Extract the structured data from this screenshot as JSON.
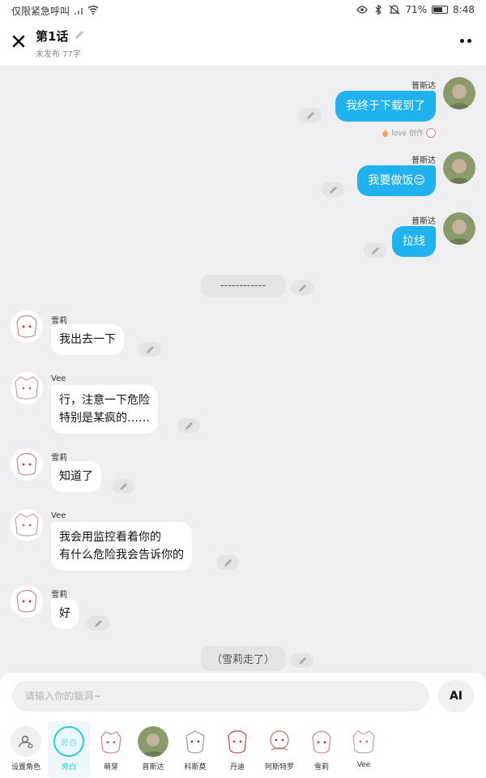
{
  "status_bar": {
    "left_text": "仅限紧急呼叫",
    "battery": "71%",
    "time": "8:48"
  },
  "header": {
    "title": "第1话",
    "subtitle": "未发布 77字"
  },
  "messages": {
    "m1": {
      "name": "普斯达",
      "text": "我终于下载到了"
    },
    "credit": "love 创作",
    "m2": {
      "name": "普斯达",
      "text": "我要做饭😌"
    },
    "m3": {
      "name": "普斯达",
      "text": "拉线"
    },
    "narr1": {
      "text": "------------"
    },
    "m4": {
      "name": "雪莉",
      "text": "我出去一下"
    },
    "m5": {
      "name": "Vee",
      "line1": "行，注意一下危险",
      "line2": "特别是某疯的……"
    },
    "m6": {
      "name": "雪莉",
      "text": "知道了"
    },
    "m7": {
      "name": "Vee",
      "line1": "我会用监控看着你的",
      "line2": "有什么危险我会告诉你的"
    },
    "m8": {
      "name": "雪莉",
      "text": "好"
    },
    "narr2": {
      "text": "（雪莉走了）"
    }
  },
  "input": {
    "placeholder": "请输入你的脑洞~",
    "ai_label": "AI"
  },
  "characters": [
    {
      "label": "设置角色",
      "icon": "add-user-icon"
    },
    {
      "label": "旁白",
      "avatar_text": "旁白",
      "selected": true
    },
    {
      "label": "萌芽"
    },
    {
      "label": "普斯达"
    },
    {
      "label": "科斯莫"
    },
    {
      "label": "丹迪"
    },
    {
      "label": "阿斯特罗"
    },
    {
      "label": "雪莉"
    },
    {
      "label": "Vee"
    }
  ],
  "colors": {
    "accent": "#1fb2ef",
    "selected": "#2ec9e6",
    "background": "#efeff1"
  }
}
